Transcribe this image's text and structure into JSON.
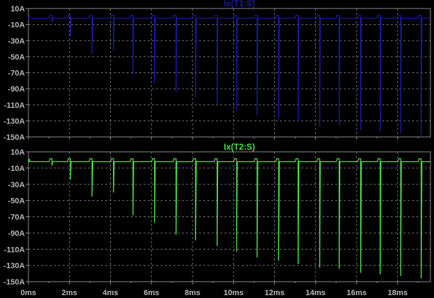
{
  "chart_data": [
    {
      "type": "line",
      "title": "Ix(T1:S)",
      "color": "#1a1aaa",
      "ylim": [
        -150,
        10
      ],
      "yticks": [
        10,
        -10,
        -30,
        -50,
        -70,
        -90,
        -110,
        -130,
        -150
      ],
      "ytick_labels": [
        "10A",
        "-10A",
        "-30A",
        "-50A",
        "-70A",
        "-90A",
        "-110A",
        "-130A",
        "-150A"
      ],
      "grid": true,
      "baseline": -2,
      "pulses": [
        {
          "t": 0.0,
          "min": -3
        },
        {
          "t": 1.15,
          "min": -7
        },
        {
          "t": 2.05,
          "min": -25
        },
        {
          "t": 3.1,
          "min": -47
        },
        {
          "t": 4.15,
          "min": -43
        },
        {
          "t": 5.1,
          "min": -72
        },
        {
          "t": 6.15,
          "min": -83
        },
        {
          "t": 7.2,
          "min": -94
        },
        {
          "t": 8.15,
          "min": -102
        },
        {
          "t": 9.2,
          "min": -110
        },
        {
          "t": 10.15,
          "min": -117
        },
        {
          "t": 11.15,
          "min": -123
        },
        {
          "t": 12.2,
          "min": -126
        },
        {
          "t": 13.15,
          "min": -131
        },
        {
          "t": 14.2,
          "min": -138
        },
        {
          "t": 15.15,
          "min": -136
        },
        {
          "t": 16.2,
          "min": -141
        },
        {
          "t": 17.15,
          "min": -143
        },
        {
          "t": 18.15,
          "min": -145
        },
        {
          "t": 19.15,
          "min": -148
        }
      ]
    },
    {
      "type": "line",
      "title": "Ix(T2:S)",
      "color": "#4ee04e",
      "ylim": [
        -150,
        10
      ],
      "yticks": [
        10,
        -10,
        -30,
        -50,
        -70,
        -90,
        -110,
        -130,
        -150
      ],
      "ytick_labels": [
        "10A",
        "-10A",
        "-30A",
        "-50A",
        "-70A",
        "-90A",
        "-110A",
        "-130A",
        "-150A"
      ],
      "grid": true,
      "baseline": -2,
      "pulses": [
        {
          "t": 0.0,
          "min": -3
        },
        {
          "t": 1.15,
          "min": -7
        },
        {
          "t": 2.05,
          "min": -24
        },
        {
          "t": 3.1,
          "min": -45
        },
        {
          "t": 4.15,
          "min": -40
        },
        {
          "t": 5.1,
          "min": -68
        },
        {
          "t": 6.15,
          "min": -77
        },
        {
          "t": 7.2,
          "min": -92
        },
        {
          "t": 8.15,
          "min": -99
        },
        {
          "t": 9.2,
          "min": -106
        },
        {
          "t": 10.15,
          "min": -113
        },
        {
          "t": 11.15,
          "min": -120
        },
        {
          "t": 12.2,
          "min": -124
        },
        {
          "t": 13.15,
          "min": -128
        },
        {
          "t": 14.2,
          "min": -133
        },
        {
          "t": 15.15,
          "min": -134
        },
        {
          "t": 16.2,
          "min": -139
        },
        {
          "t": 17.15,
          "min": -141
        },
        {
          "t": 18.15,
          "min": -143
        },
        {
          "t": 19.15,
          "min": -146
        }
      ]
    }
  ],
  "x_axis": {
    "xlim": [
      0,
      19.6
    ],
    "ticks": [
      0,
      2,
      4,
      6,
      8,
      10,
      12,
      14,
      16,
      18
    ],
    "tick_labels": [
      "0ms",
      "2ms",
      "4ms",
      "6ms",
      "8ms",
      "10ms",
      "12ms",
      "14ms",
      "16ms",
      "18ms"
    ],
    "minor_ticks": [
      1,
      3,
      5,
      7,
      9,
      11,
      13,
      15,
      17,
      19
    ]
  },
  "style": {
    "background": "#000000",
    "frame_color": "#8a8a8a",
    "grid_color": "#6e6e6e",
    "label_color": "#b8b8b8"
  }
}
